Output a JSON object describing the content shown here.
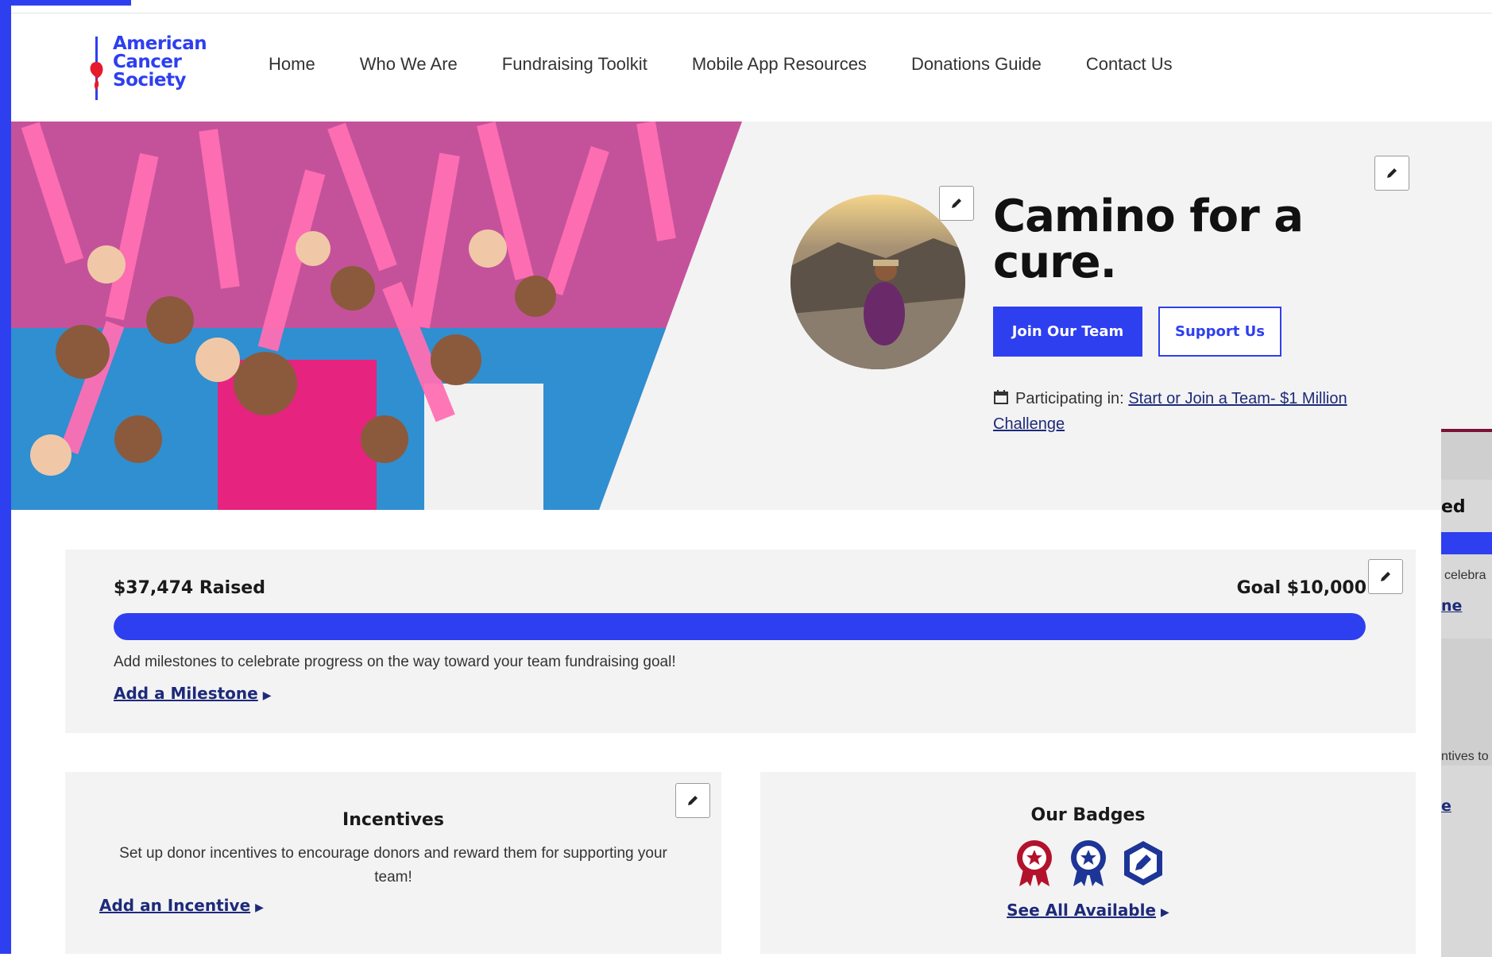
{
  "logo": {
    "line1": "American",
    "line2": "Cancer",
    "line3": "Society"
  },
  "nav": [
    "Home",
    "Who We Are",
    "Fundraising Toolkit",
    "Mobile App Resources",
    "Donations Guide",
    "Contact Us"
  ],
  "hero": {
    "title": "Camino for a cure.",
    "join_label": "Join Our Team",
    "support_label": "Support Us",
    "participating_label": "Participating in:",
    "participating_link": "Start or Join a Team- $1 Million Challenge"
  },
  "progress": {
    "raised": "$37,474 Raised",
    "goal": "Goal $10,000",
    "fill_fraction": 1.0,
    "milestone_text": "Add milestones to celebrate progress on the way toward your team fundraising goal!",
    "milestone_link": "Add a Milestone"
  },
  "incentives": {
    "title": "Incentives",
    "description": "Set up donor incentives to encourage donors and reward them for supporting your team!",
    "link": "Add an Incentive"
  },
  "badges": {
    "title": "Our Badges",
    "link": "See All Available",
    "icons": [
      "ribbon-star-icon",
      "ribbon-star-icon",
      "pencil-hexagon-icon"
    ]
  },
  "overlay": {
    "frag1": "ed",
    "frag2": "celebra",
    "frag3": "ne",
    "frag4": "ntives to",
    "frag5": "e"
  },
  "colors": {
    "accent": "#2e3ff0",
    "link": "#1d2a7a",
    "logo_red": "#e51a2d",
    "badge_red": "#b3122c",
    "badge_blue": "#1d3596"
  }
}
